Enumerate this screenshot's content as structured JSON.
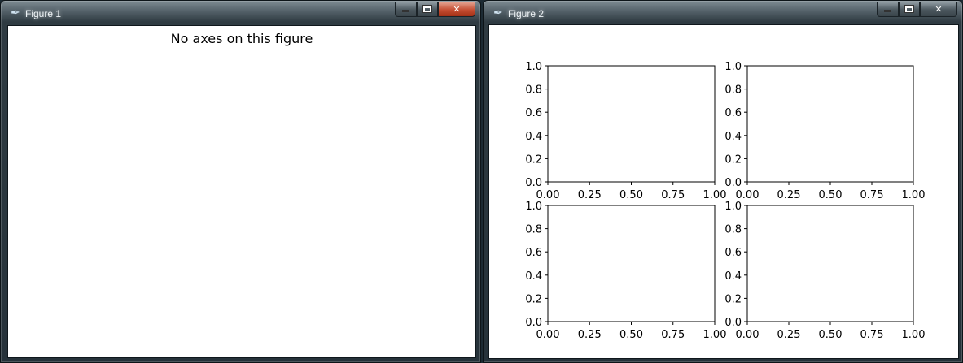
{
  "windows": [
    {
      "title": "Figure 1",
      "app_icon": "feather-icon",
      "message": "No axes on this figure",
      "caption_buttons": {
        "minimize": "minimize",
        "maximize": "maximize",
        "close": "✕"
      }
    },
    {
      "title": "Figure 2",
      "app_icon": "feather-icon",
      "caption_buttons": {
        "minimize": "minimize",
        "maximize": "maximize",
        "close": "✕"
      }
    }
  ],
  "chart_data": [
    {
      "type": "line",
      "series": [],
      "xlim": [
        0,
        1
      ],
      "ylim": [
        0,
        1
      ],
      "xticks": [
        "0.00",
        "0.25",
        "0.50",
        "0.75",
        "1.00"
      ],
      "yticks": [
        "0.0",
        "0.2",
        "0.4",
        "0.6",
        "0.8",
        "1.0"
      ],
      "grid": false
    },
    {
      "type": "line",
      "series": [],
      "xlim": [
        0,
        1
      ],
      "ylim": [
        0,
        1
      ],
      "xticks": [
        "0.00",
        "0.25",
        "0.50",
        "0.75",
        "1.00"
      ],
      "yticks": [
        "0.0",
        "0.2",
        "0.4",
        "0.6",
        "0.8",
        "1.0"
      ],
      "grid": false
    },
    {
      "type": "line",
      "series": [],
      "xlim": [
        0,
        1
      ],
      "ylim": [
        0,
        1
      ],
      "xticks": [
        "0.00",
        "0.25",
        "0.50",
        "0.75",
        "1.00"
      ],
      "yticks": [
        "0.0",
        "0.2",
        "0.4",
        "0.6",
        "0.8",
        "1.0"
      ],
      "grid": false
    },
    {
      "type": "line",
      "series": [],
      "xlim": [
        0,
        1
      ],
      "ylim": [
        0,
        1
      ],
      "xticks": [
        "0.00",
        "0.25",
        "0.50",
        "0.75",
        "1.00"
      ],
      "yticks": [
        "0.0",
        "0.2",
        "0.4",
        "0.6",
        "0.8",
        "1.0"
      ],
      "grid": false
    }
  ]
}
